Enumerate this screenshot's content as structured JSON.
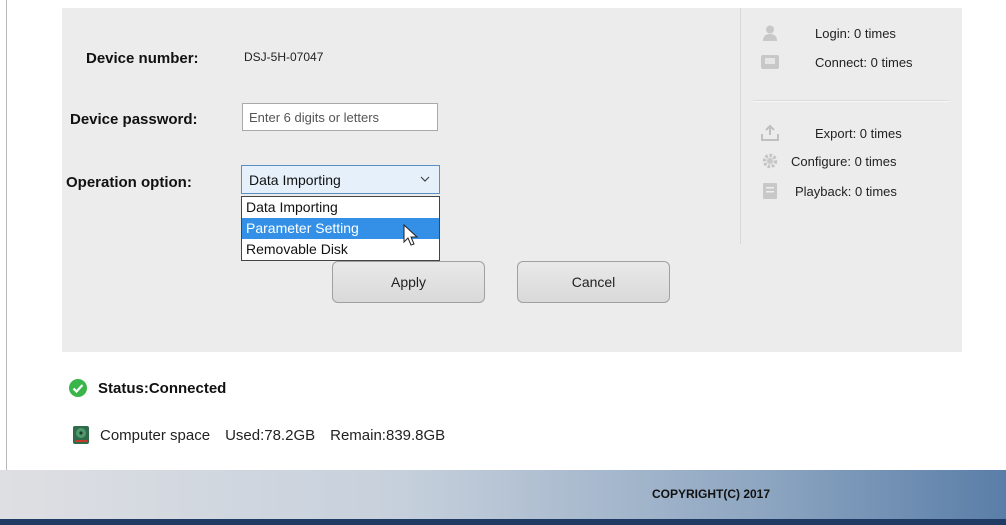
{
  "form": {
    "device_number_label": "Device number:",
    "device_number_value": "DSJ-5H-07047",
    "device_password_label": "Device password:",
    "device_password_placeholder": "Enter 6 digits or letters",
    "device_password_value": "",
    "operation_option_label": "Operation option:",
    "operation_option_selected": "Data Importing",
    "operation_options": [
      "Data Importing",
      "Parameter Setting",
      "Removable Disk"
    ],
    "highlighted_option": "Parameter Setting",
    "apply_label": "Apply",
    "cancel_label": "Cancel"
  },
  "stats": {
    "login": "Login: 0 times",
    "connect": "Connect: 0 times",
    "export": "Export: 0 times",
    "configure": "Configure: 0 times",
    "playback": "Playback: 0 times"
  },
  "status": {
    "text": "Status:Connected",
    "color": "#3ab54a"
  },
  "disk": {
    "label": "Computer space",
    "used": "Used:78.2GB",
    "remain": "Remain:839.8GB"
  },
  "footer": {
    "copyright": "COPYRIGHT(C) 2017"
  },
  "icons": {
    "login": "user-icon",
    "connect": "device-icon",
    "export": "export-icon",
    "configure": "gear-icon",
    "playback": "document-icon",
    "status": "check-circle-icon",
    "disk": "hard-disk-icon",
    "dropdown": "chevron-down-icon",
    "cursor": "mouse-cursor-icon"
  }
}
